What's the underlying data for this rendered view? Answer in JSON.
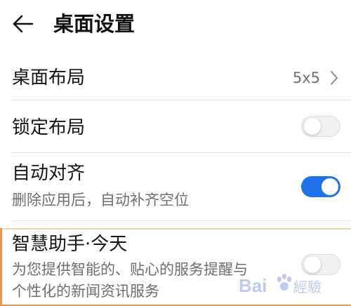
{
  "header": {
    "title": "桌面设置",
    "back_icon": "arrow-left-icon"
  },
  "rows": [
    {
      "label": "桌面布局",
      "value": "5x5",
      "icon": "chevron-right-icon"
    },
    {
      "label": "锁定布局",
      "toggle": "off"
    },
    {
      "label": "自动对齐",
      "subtitle": "删除应用后，自动补齐空位",
      "toggle": "on"
    },
    {
      "label": "智慧助手·今天",
      "subtitle_line1": "为您提供智能的、贴心的服务提醒与",
      "subtitle_line2": "个性化的新闻资讯服务",
      "toggle": "off"
    }
  ],
  "colors": {
    "accent": "#1f72e8",
    "toggle_off": "#f1f1f1",
    "secondary_text": "#6e6e6e",
    "divider": "#e6e6e6"
  },
  "watermark": {
    "text": "Bai經驗",
    "icon": "paw-logo"
  }
}
